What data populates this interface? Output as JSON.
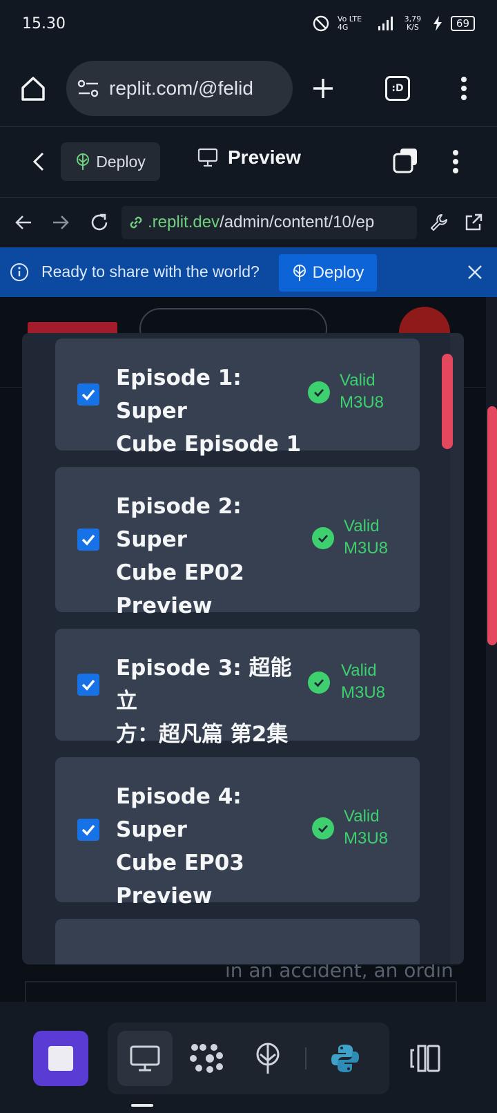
{
  "status_bar": {
    "time": "15.30",
    "network": "Vo LTE 4G",
    "speed": "3,79 K/S",
    "battery": "69"
  },
  "browser": {
    "url": "replit.com/@felid"
  },
  "replit_header": {
    "deploy_label": "Deploy",
    "preview_label": "Preview"
  },
  "address_bar": {
    "host": ".replit.dev",
    "path": "/admin/content/10/ep"
  },
  "banner": {
    "message": "Ready to share with the world?",
    "deploy_label": "Deploy"
  },
  "background_text": "in an accident, an ordin",
  "episodes": [
    {
      "title_lines": [
        "Episode 1: Super",
        "Cube Episode 1"
      ],
      "checked": true,
      "status_line1": "Valid",
      "status_line2": "M3U8"
    },
    {
      "title_lines": [
        "Episode 2: Super",
        "Cube EP02",
        "Preview"
      ],
      "checked": true,
      "status_line1": "Valid",
      "status_line2": "M3U8"
    },
    {
      "title_lines": [
        "Episode 3: 超能立",
        "方：超凡篇 第2集"
      ],
      "checked": true,
      "status_line1": "Valid",
      "status_line2": "M3U8"
    },
    {
      "title_lines": [
        "Episode 4: Super",
        "Cube EP03",
        "Preview"
      ],
      "checked": true,
      "status_line1": "Valid",
      "status_line2": "M3U8"
    }
  ],
  "colors": {
    "valid": "#3ecf6f",
    "checkbox": "#1672e6",
    "banner": "#0b4aa0",
    "scroll_thumb": "#e3485e",
    "stop_button": "#5a3bd4"
  },
  "bottom_nav": {
    "items": [
      "stop-icon",
      "preview-icon",
      "agents-icon",
      "deploy-icon",
      "python-icon",
      "panels-icon"
    ]
  }
}
